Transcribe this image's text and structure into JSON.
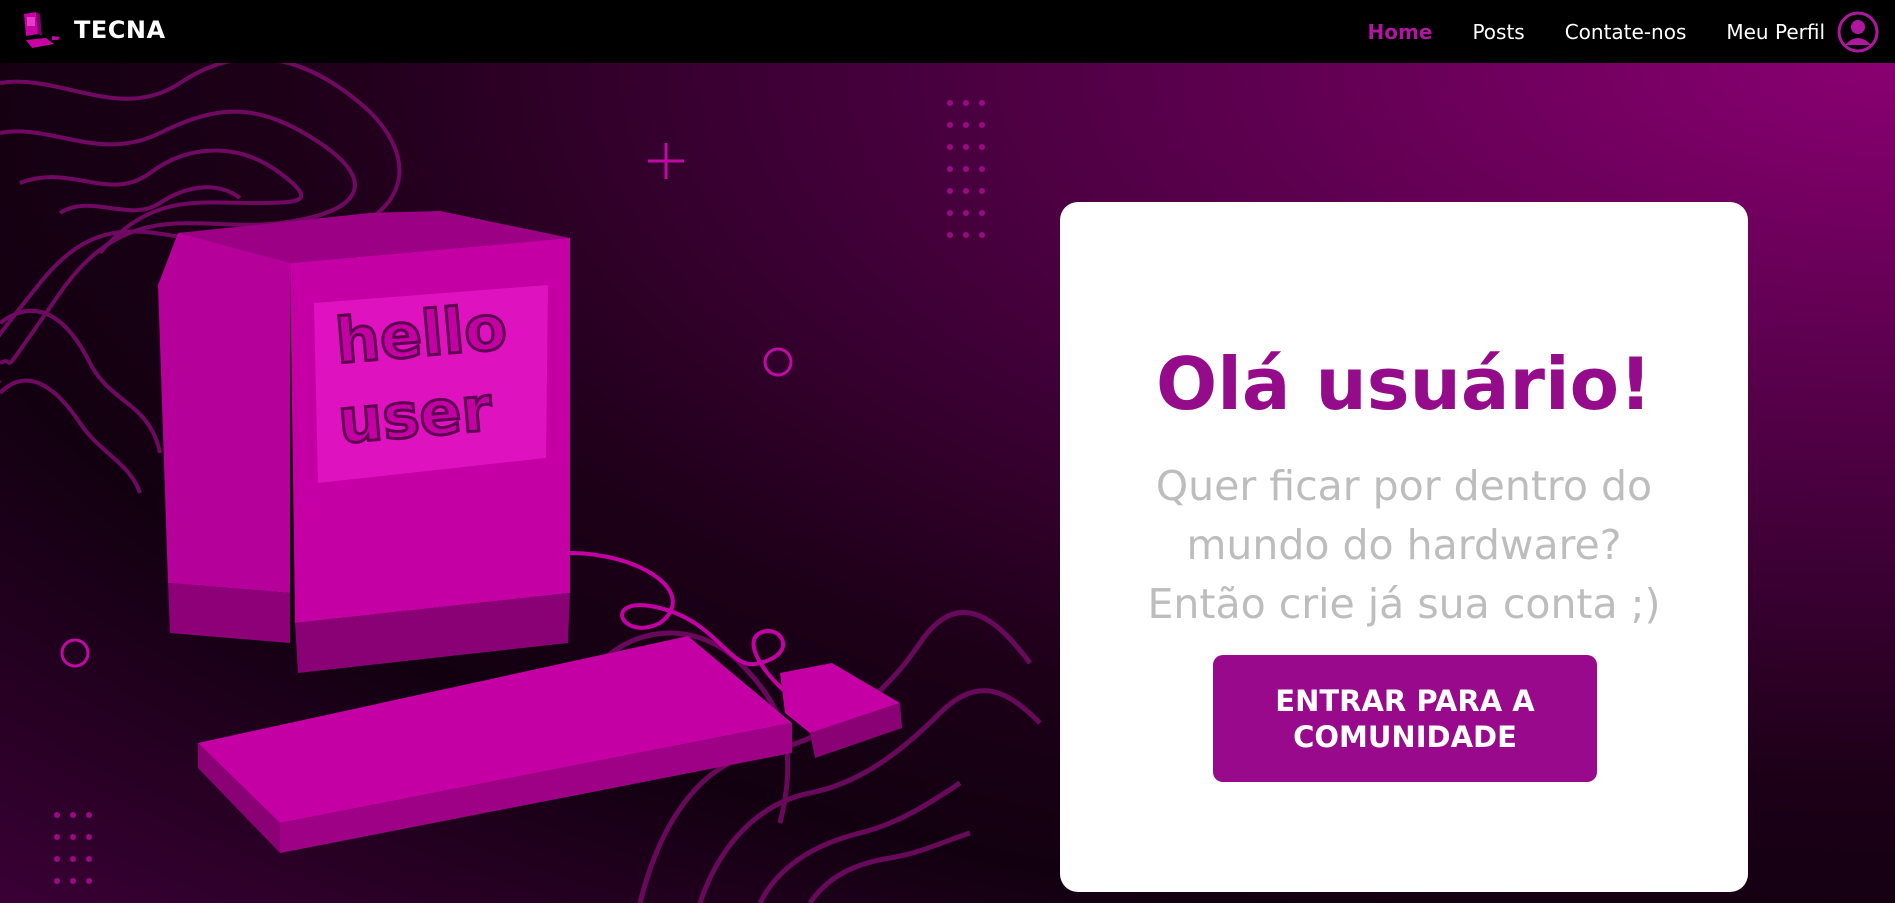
{
  "brand": {
    "name": "TECNA",
    "logo_icon": "computer-logo-icon"
  },
  "nav": {
    "items": [
      {
        "label": "Home",
        "active": true
      },
      {
        "label": "Posts",
        "active": false
      },
      {
        "label": "Contate-nos",
        "active": false
      }
    ],
    "profile_label": "Meu Perfil",
    "profile_icon": "user-circle-icon"
  },
  "hero": {
    "illustration_icon": "retro-computer-illustration",
    "screen_text": "hello user"
  },
  "card": {
    "title": "Olá usuário!",
    "subtitle_lines": [
      "Quer ficar por dentro do",
      "mundo do hardware?",
      "Então crie já sua conta ;)"
    ],
    "button_lines": [
      "ENTRAR PARA A",
      "COMUNIDADE"
    ]
  },
  "colors": {
    "accent": "#980a8b",
    "title": "#950c8a",
    "active_nav": "#b0179e",
    "subtitle": "#bdbdbd",
    "navbar_bg": "#000000",
    "magenta": "#c800a6"
  }
}
